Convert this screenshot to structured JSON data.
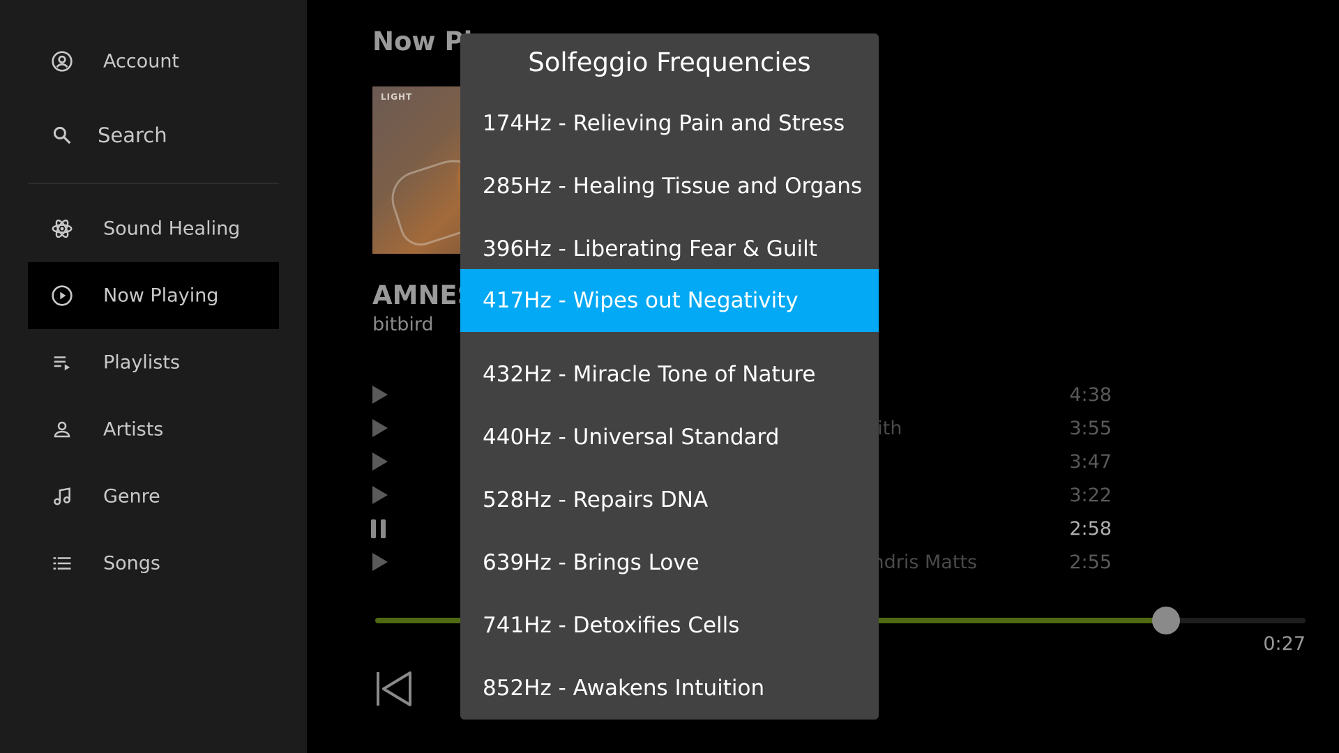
{
  "sidebar": {
    "items": [
      {
        "label": "Account",
        "icon": "account-circle-icon"
      },
      {
        "label": "Search",
        "icon": "search-icon"
      },
      {
        "label": "Sound Healing",
        "icon": "atom-icon"
      },
      {
        "label": "Now Playing",
        "icon": "play-circle-icon",
        "active": true
      },
      {
        "label": "Playlists",
        "icon": "playlist-icon"
      },
      {
        "label": "Artists",
        "icon": "person-icon"
      },
      {
        "label": "Genre",
        "icon": "music-note-icon"
      },
      {
        "label": "Songs",
        "icon": "list-icon"
      }
    ]
  },
  "main": {
    "page_title": "Now Pla",
    "track_title": "AMNES",
    "track_artist": "bitbird",
    "tracks": [
      {
        "artist_visible": "",
        "duration": "4:38",
        "state": "play"
      },
      {
        "artist_visible": "mith",
        "duration": "3:55",
        "state": "play"
      },
      {
        "artist_visible": "",
        "duration": "3:47",
        "state": "play"
      },
      {
        "artist_visible": "",
        "duration": "3:22",
        "state": "play"
      },
      {
        "artist_visible": "",
        "duration": "2:58",
        "state": "pause"
      },
      {
        "artist_visible": "Andris Matts",
        "duration": "2:55",
        "state": "play"
      }
    ],
    "progress_fraction": 0.85,
    "elapsed_time": "0:27"
  },
  "dialog": {
    "title": "Solfeggio Frequencies",
    "options": [
      "174Hz - Relieving Pain and Stress",
      "285Hz - Healing Tissue and Organs",
      "396Hz - Liberating Fear & Guilt",
      "417Hz - Wipes out Negativity",
      "432Hz - Miracle Tone of Nature",
      "440Hz - Universal Standard",
      "528Hz - Repairs DNA",
      "639Hz - Brings Love",
      "741Hz - Detoxifies Cells",
      "852Hz - Awakens Intuition"
    ],
    "selected_index": 3
  },
  "colors": {
    "accent": "#03a9f4",
    "progress": "#4f6a12",
    "dialog_bg": "#424242",
    "sidebar_bg": "#1c1c1c"
  }
}
